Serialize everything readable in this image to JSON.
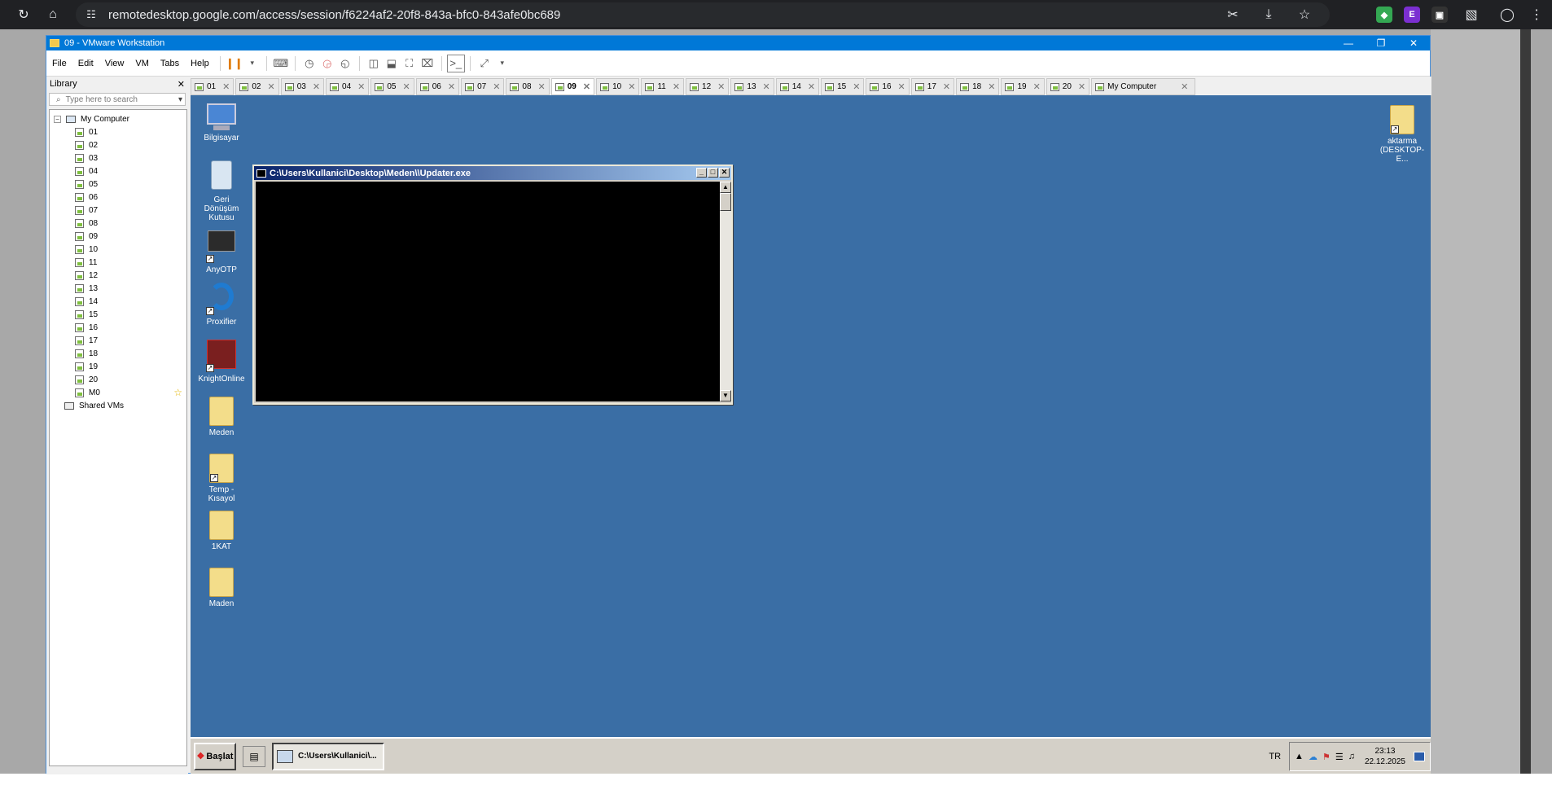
{
  "browser": {
    "url": "remotedesktop.google.com/access/session/f6224af2-20f8-843a-bfc0-843afe0bc689",
    "icons": [
      "reload-icon",
      "home-icon",
      "site-info-icon",
      "screenshot-icon",
      "install-icon",
      "bookmark-star-icon",
      "shield-extension-icon",
      "e-extension-icon",
      "game-extension-icon",
      "extensions-puzzle-icon",
      "profile-icon",
      "more-menu-icon"
    ]
  },
  "vmware": {
    "title": "09 - VMware Workstation",
    "menu": [
      "File",
      "Edit",
      "View",
      "VM",
      "Tabs",
      "Help"
    ],
    "library": {
      "header": "Library",
      "search_placeholder": "Type here to search",
      "root": "My Computer",
      "vms": [
        "01",
        "02",
        "03",
        "04",
        "05",
        "06",
        "07",
        "08",
        "09",
        "10",
        "11",
        "12",
        "13",
        "14",
        "15",
        "16",
        "17",
        "18",
        "19",
        "20",
        "M0"
      ],
      "shared": "Shared VMs"
    },
    "tabs": [
      "01",
      "02",
      "03",
      "04",
      "05",
      "06",
      "07",
      "08",
      "09",
      "10",
      "11",
      "12",
      "13",
      "14",
      "15",
      "16",
      "17",
      "18",
      "19",
      "20",
      "My Computer"
    ],
    "active_tab": "09"
  },
  "guest": {
    "desktop_icons": [
      {
        "label": "Bilgisayar"
      },
      {
        "label": "Geri Dönüşüm Kutusu"
      },
      {
        "label": "AnyOTP"
      },
      {
        "label": "Proxifier"
      },
      {
        "label": "KnightOnline"
      },
      {
        "label": "Meden"
      },
      {
        "label": "Temp - Kısayol"
      },
      {
        "label": "1KAT"
      },
      {
        "label": "Maden"
      }
    ],
    "right_icon": {
      "label": "aktarma (DESKTOP-E..."
    },
    "console": {
      "title": "C:\\Users\\Kullanici\\Desktop\\Meden\\\\Updater.exe"
    },
    "taskbar": {
      "start": "Başlat",
      "task_item": "C:\\Users\\Kullanici\\...",
      "lang": "TR",
      "time": "23:13",
      "date": "22.12.2025"
    }
  }
}
